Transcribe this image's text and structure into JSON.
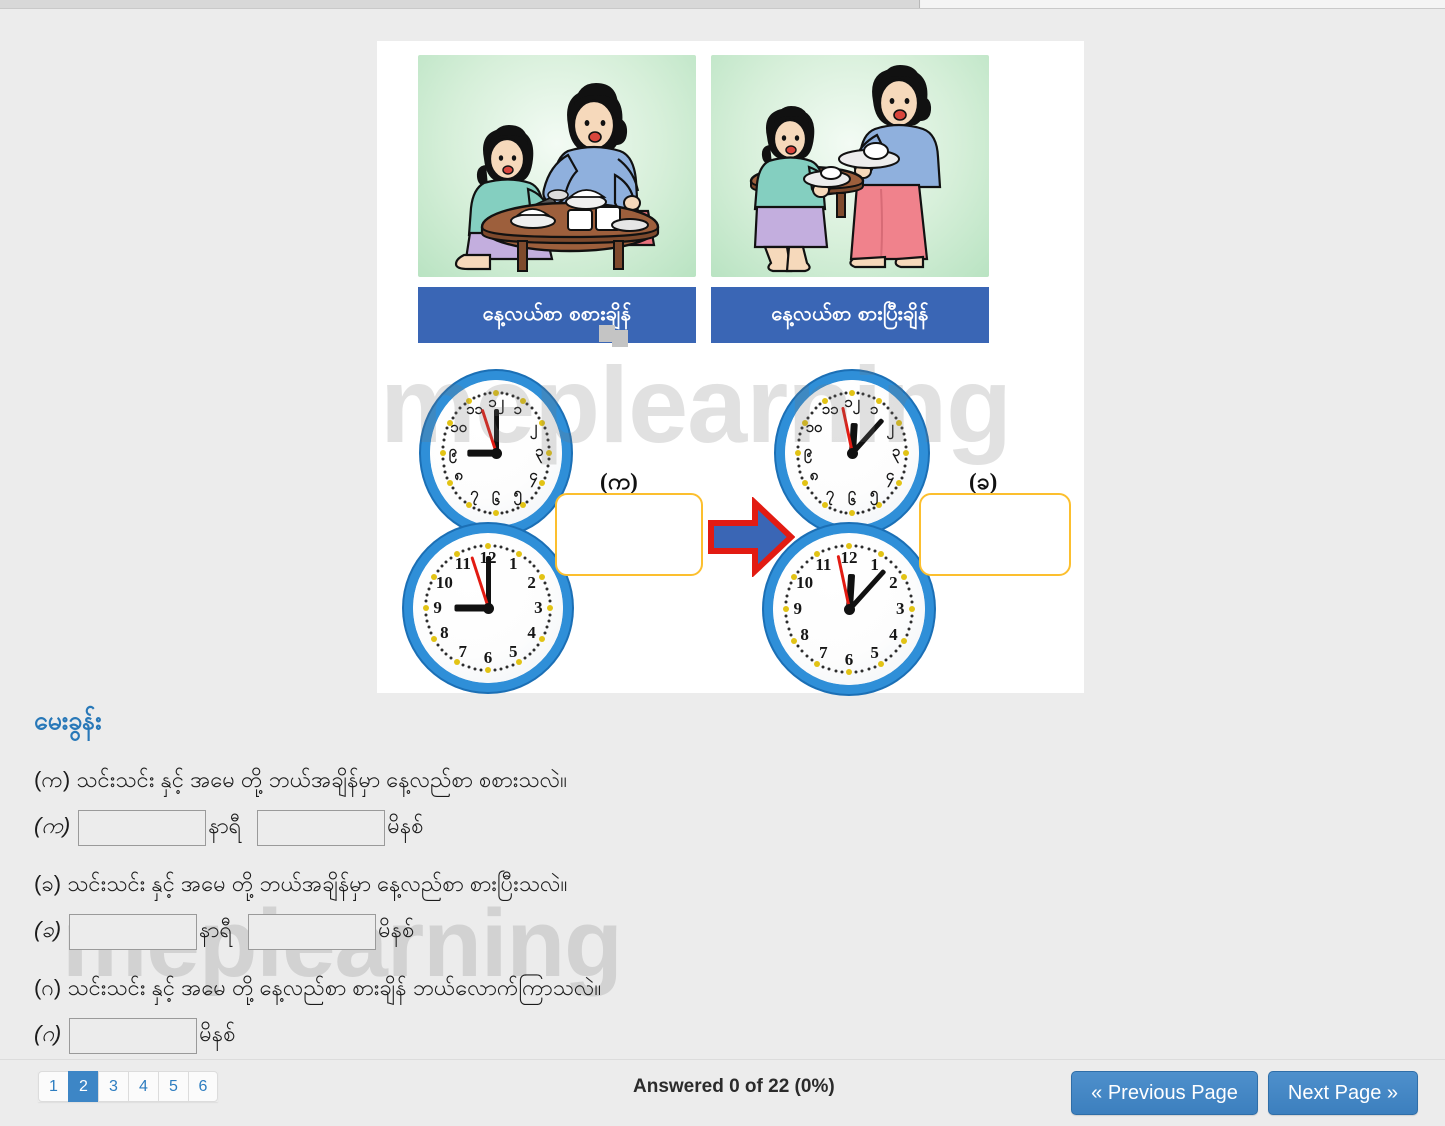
{
  "page": {
    "background_color": "#ececec",
    "watermark_text": "meplearning"
  },
  "illustration": {
    "panels": [
      {
        "caption": "နေ့လယ်စာ စစားချိန်",
        "caption_bg": "#3a66b5",
        "art_alt": "girl-eating-with-mother-at-low-table"
      },
      {
        "caption": "နေ့လယ်စာ စားပြီးချိန်",
        "caption_bg": "#3a66b5",
        "art_alt": "girl-and-mother-carrying-dishes-away"
      }
    ],
    "arrow": {
      "fill": "#3a66b5",
      "stroke": "#e21b12"
    },
    "clock_groups": [
      {
        "label": "(က)",
        "answer_box_border": "#fcbf2e",
        "answer_box_value": "",
        "clocks": [
          {
            "numeral_system": "burmese",
            "numerals": [
              "၁၂",
              "၁",
              "၂",
              "၃",
              "၄",
              "၅",
              "၆",
              "၇",
              "၈",
              "၉",
              "၁၀",
              "၁၁"
            ],
            "hour": 9,
            "minute": 0,
            "second": 57
          },
          {
            "numeral_system": "arabic",
            "numerals": [
              "12",
              "1",
              "2",
              "3",
              "4",
              "5",
              "6",
              "7",
              "8",
              "9",
              "10",
              "11"
            ],
            "hour": 9,
            "minute": 0,
            "second": 57
          }
        ]
      },
      {
        "label": "(ခ)",
        "answer_box_border": "#fcbf2e",
        "answer_box_value": "",
        "clocks": [
          {
            "numeral_system": "burmese",
            "numerals": [
              "၁၂",
              "၁",
              "၂",
              "၃",
              "၄",
              "၅",
              "၆",
              "၇",
              "၈",
              "၉",
              "၁၀",
              "၁၁"
            ],
            "hour": 12,
            "minute": 7,
            "second": 58
          },
          {
            "numeral_system": "arabic",
            "numerals": [
              "12",
              "1",
              "2",
              "3",
              "4",
              "5",
              "6",
              "7",
              "8",
              "9",
              "10",
              "11"
            ],
            "hour": 12,
            "minute": 7,
            "second": 58
          }
        ]
      }
    ]
  },
  "questions": {
    "heading": "မေးခွန်း",
    "items": [
      {
        "tag": "(က)",
        "prompt": "(က)  သင်းသင်း နှင့် အမေ တို့ ဘယ်အချိန်မှာ နေ့လည်စာ စစားသလဲ။",
        "answer_tag": "(က)",
        "fields": [
          {
            "value": "",
            "unit": "နာရီ"
          },
          {
            "value": "",
            "unit": "မိနစ်"
          }
        ]
      },
      {
        "tag": "(ခ)",
        "prompt": "(ခ)  သင်းသင်း နှင့် အမေ တို့ ဘယ်အချိန်မှာ နေ့လည်စာ စားပြီးသလဲ။",
        "answer_tag": "(ခ)",
        "fields": [
          {
            "value": "",
            "unit": "နာရီ"
          },
          {
            "value": "",
            "unit": "မိနစ်"
          }
        ]
      },
      {
        "tag": "(ဂ)",
        "prompt": "(ဂ) သင်းသင်း နှင့် အမေ တို့  နေ့လည်စာ စားချိန် ဘယ်လောက်ကြာသလဲ။",
        "answer_tag": "(ဂ)",
        "fields": [
          {
            "value": "",
            "unit": "မိနစ်"
          }
        ]
      }
    ]
  },
  "bottom_bar": {
    "pages": [
      "1",
      "2",
      "3",
      "4",
      "5",
      "6"
    ],
    "active_page": "2",
    "answered_status": "Answered 0 of 22 (0%)",
    "previous_label": "« Previous Page",
    "next_label": "Next Page »",
    "button_color": "#3d86c6"
  }
}
